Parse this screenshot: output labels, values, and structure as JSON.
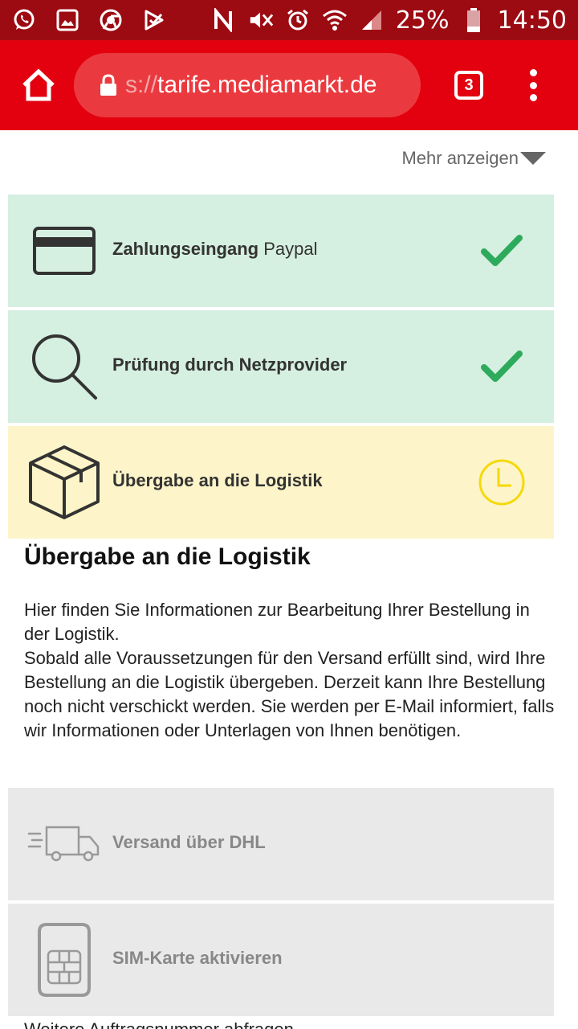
{
  "status_bar": {
    "battery": "25%",
    "time": "14:50",
    "icons": [
      "whatsapp-icon",
      "gallery-icon",
      "chrome-icon",
      "checkmark-app-icon",
      "nfc-icon",
      "mute-icon",
      "alarm-icon",
      "wifi-icon",
      "signal-icon",
      "battery-icon"
    ]
  },
  "browser": {
    "url_prefix": "s://",
    "url_main": "tarife.mediamarkt.de",
    "tab_count": "3"
  },
  "more_link": "Mehr anzeigen",
  "steps": [
    {
      "label_bold": "Zahlungseingang",
      "label_rest": "Paypal",
      "state": "done",
      "icon": "credit-card-icon",
      "status_icon": "checkmark-icon"
    },
    {
      "label_bold": "Prüfung durch Netzprovider",
      "label_rest": "",
      "state": "done",
      "icon": "search-icon",
      "status_icon": "checkmark-icon"
    },
    {
      "label_bold": "Übergabe an die Logistik",
      "label_rest": "",
      "state": "pending",
      "icon": "package-icon",
      "status_icon": "clock-icon"
    },
    {
      "label_bold": "Versand über DHL",
      "label_rest": "",
      "state": "inactive",
      "icon": "truck-icon"
    },
    {
      "label_bold": "SIM-Karte aktivieren",
      "label_rest": "",
      "state": "inactive",
      "icon": "sim-card-icon"
    }
  ],
  "section": {
    "title": "Übergabe an die Logistik",
    "paragraph1": "Hier finden Sie Informationen zur Bearbeitung Ihrer Bestellung in der Logistik.",
    "paragraph2": "Sobald alle Voraussetzungen für den Versand erfüllt sind, wird Ihre Bestellung an die Logistik übergeben. Derzeit kann Ihre Bestellung noch nicht verschickt werden. Sie werden per E-Mail informiert, falls wir Informationen oder Unterlagen von Ihnen benötigen."
  },
  "peek_text": "Weitere Auftragsnummer abfragen",
  "colors": {
    "status_bar": "#9c0a12",
    "browser_bar": "#e3010f",
    "done_bg": "#d5efe0",
    "pending_bg": "#fdf5c9",
    "inactive_bg": "#e9e9e9",
    "check_green": "#2eaa5c",
    "clock_yellow": "#f5d90a"
  }
}
